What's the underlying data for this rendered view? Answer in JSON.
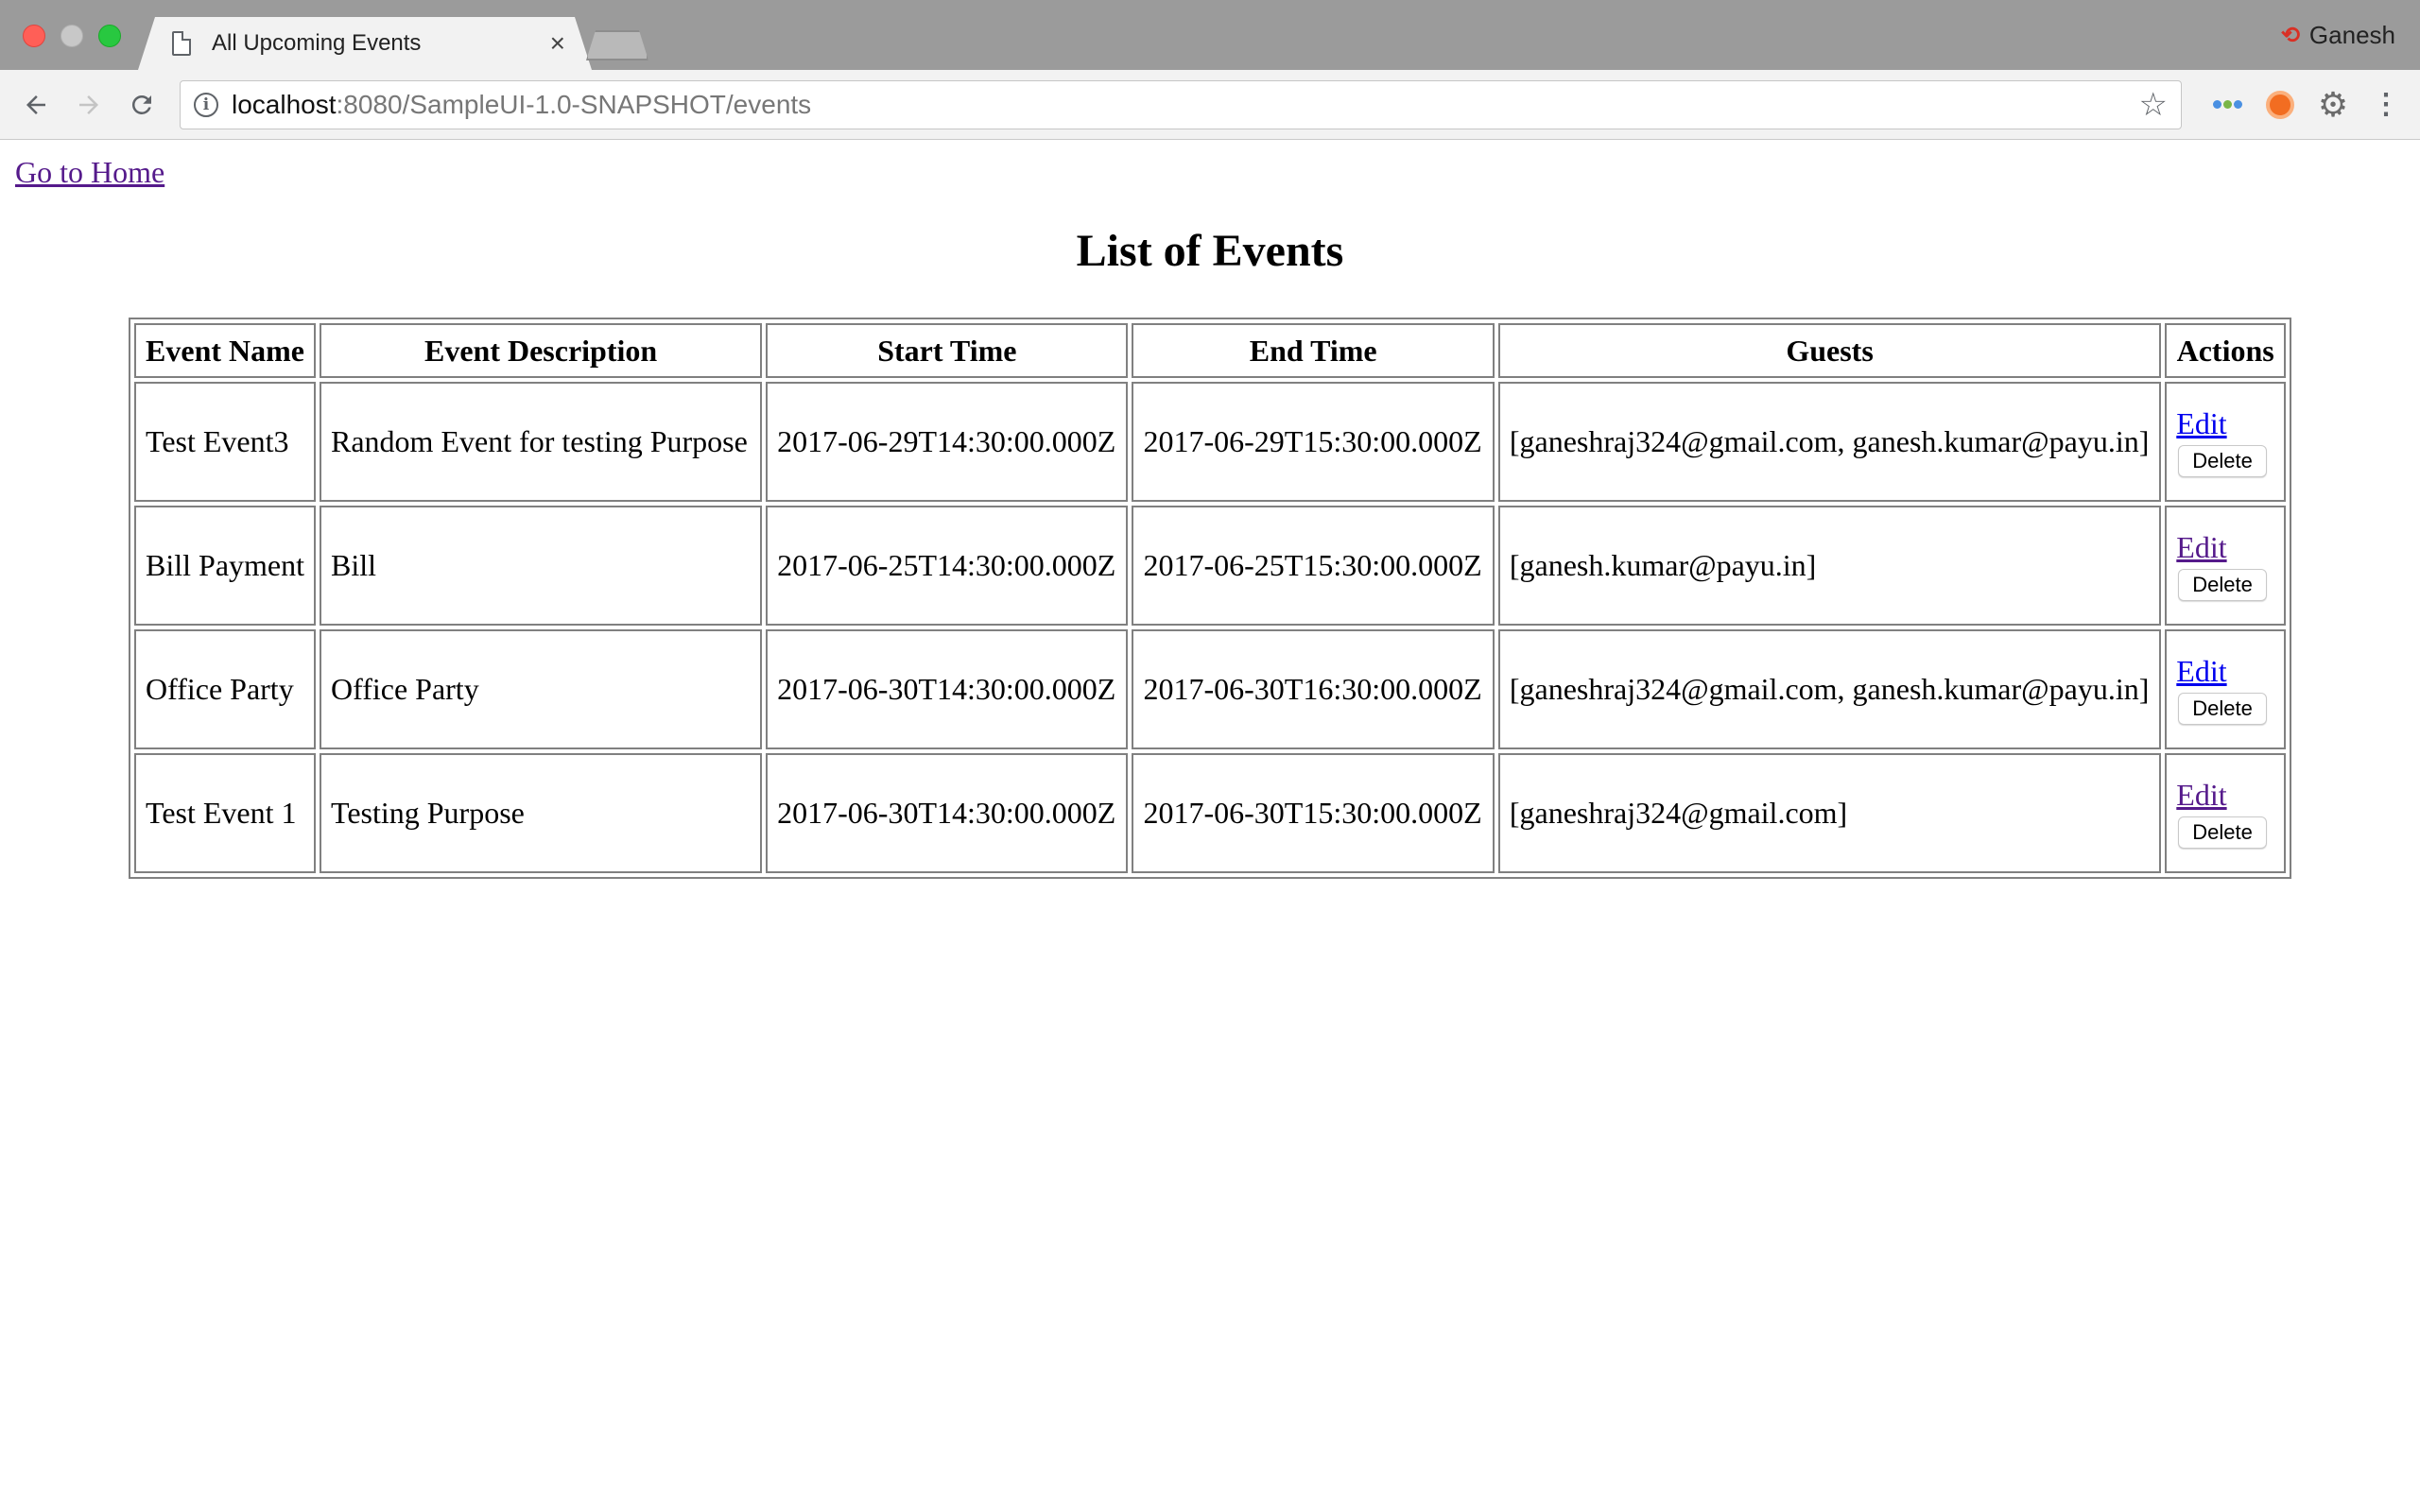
{
  "browser": {
    "tab_title": "All Upcoming Events",
    "tab_close": "×",
    "profile_name": "Ganesh",
    "url_host": "localhost",
    "url_rest": ":8080/SampleUI-1.0-SNAPSHOT/events"
  },
  "page": {
    "home_link": "Go to Home",
    "title": "List of Events",
    "columns": [
      "Event Name",
      "Event Description",
      "Start Time",
      "End Time",
      "Guests",
      "Actions"
    ],
    "rows": [
      {
        "name": "Test Event3",
        "description": "Random Event for testing Purpose",
        "start": "2017-06-29T14:30:00.000Z",
        "end": "2017-06-29T15:30:00.000Z",
        "guests": "[ganeshraj324@gmail.com, ganesh.kumar@payu.in]",
        "edit_label": "Edit",
        "delete_label": "Delete"
      },
      {
        "name": "Bill Payment",
        "description": "Bill",
        "start": "2017-06-25T14:30:00.000Z",
        "end": "2017-06-25T15:30:00.000Z",
        "guests": "[ganesh.kumar@payu.in]",
        "edit_label": "Edit",
        "delete_label": "Delete"
      },
      {
        "name": "Office Party",
        "description": "Office Party",
        "start": "2017-06-30T14:30:00.000Z",
        "end": "2017-06-30T16:30:00.000Z",
        "guests": "[ganeshraj324@gmail.com, ganesh.kumar@payu.in]",
        "edit_label": "Edit",
        "delete_label": "Delete"
      },
      {
        "name": "Test Event 1",
        "description": "Testing Purpose",
        "start": "2017-06-30T14:30:00.000Z",
        "end": "2017-06-30T15:30:00.000Z",
        "guests": "[ganeshraj324@gmail.com]",
        "edit_label": "Edit",
        "delete_label": "Delete"
      }
    ]
  },
  "colors": {
    "link_unvisited": "#0000ee",
    "link_visited": "#551a8b",
    "titlebar": "#9b9b9b"
  },
  "icons": {
    "back": "back-arrow-icon",
    "forward": "forward-arrow-icon",
    "reload": "reload-icon",
    "info": "info-icon",
    "bookmark": "star-icon",
    "menu": "kebab-menu-icon"
  }
}
